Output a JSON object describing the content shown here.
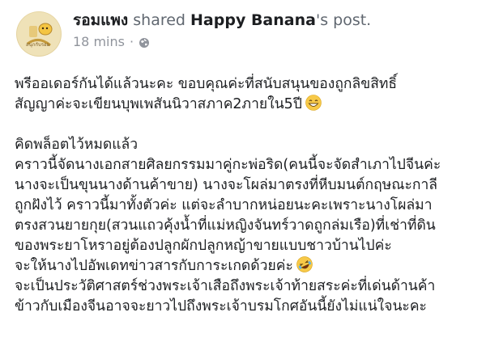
{
  "post": {
    "author_name": "รอมแพง",
    "action_text": "shared",
    "shared_page": "Happy Banana",
    "possessive": "'s post.",
    "time": "18 mins",
    "privacy_icon": "globe-icon",
    "avatar_text": "สนุกกับรอม",
    "paragraphs": [
      {
        "lines": [
          "พรีออเดอร์กันได้แล้วนะคะ ขอบคุณค่ะที่สนับสนุนของถูกลิขสิทธิ์",
          "สัญญาค่ะจะเขียนบุพเพสันนิวาสภาค2ภายใน5ปี"
        ],
        "trailing_emoji": "grinning-face-emoji"
      },
      {
        "lines": [
          "คิดพล็อตไว้หมดแล้ว",
          "คราวนี้จัดนางเอกสายศิลยกรรมมาคู่กะพ่อริด(คนนี้จะจัดสำเภาไปจีนค่ะ",
          "นางจะเป็นขุนนางด้านค้าขาย) นางจะโผล่มาตรงที่หีบมนต์กฤษณะกาลี",
          "ถูกฝังไว้ คราวนี้มาทั้งตัวค่ะ แต่จะลำบากหน่อยนะคะเพราะนางโผล่มา",
          "ตรงสวนยายกุย(สวนแถวคุ้งน้ำที่แม่หญิงจันทร์วาดถูกล่มเรือ)ที่เช่าที่ดิน",
          "ของพระยาโหราอยู่ต้องปลูกผักปลูกหญ้าขายแบบชาวบ้านไปค่ะ",
          "จะให้นางไปอัพเดทข่าวสารกับการะเกดด้วยค่ะ"
        ],
        "trailing_emoji": "rolling-laughing-emoji"
      },
      {
        "lines": [
          "จะเป็นประวัติศาสตร์ช่วงพระเจ้าเสือถึงพระเจ้าท้ายสระค่ะที่เด่นด้านค้า",
          "ข้าวกับเมืองจีนอาจจะยาวไปถึงพระเจ้าบรมโกศอันนี้ยังไม่แน่ใจนะคะ"
        ],
        "trailing_emoji": ""
      }
    ]
  },
  "colors": {
    "text": "#1c1e21",
    "meta": "#90949c",
    "emoji_face": "#f7c948",
    "avatar_bg": "#e9d9a8"
  }
}
